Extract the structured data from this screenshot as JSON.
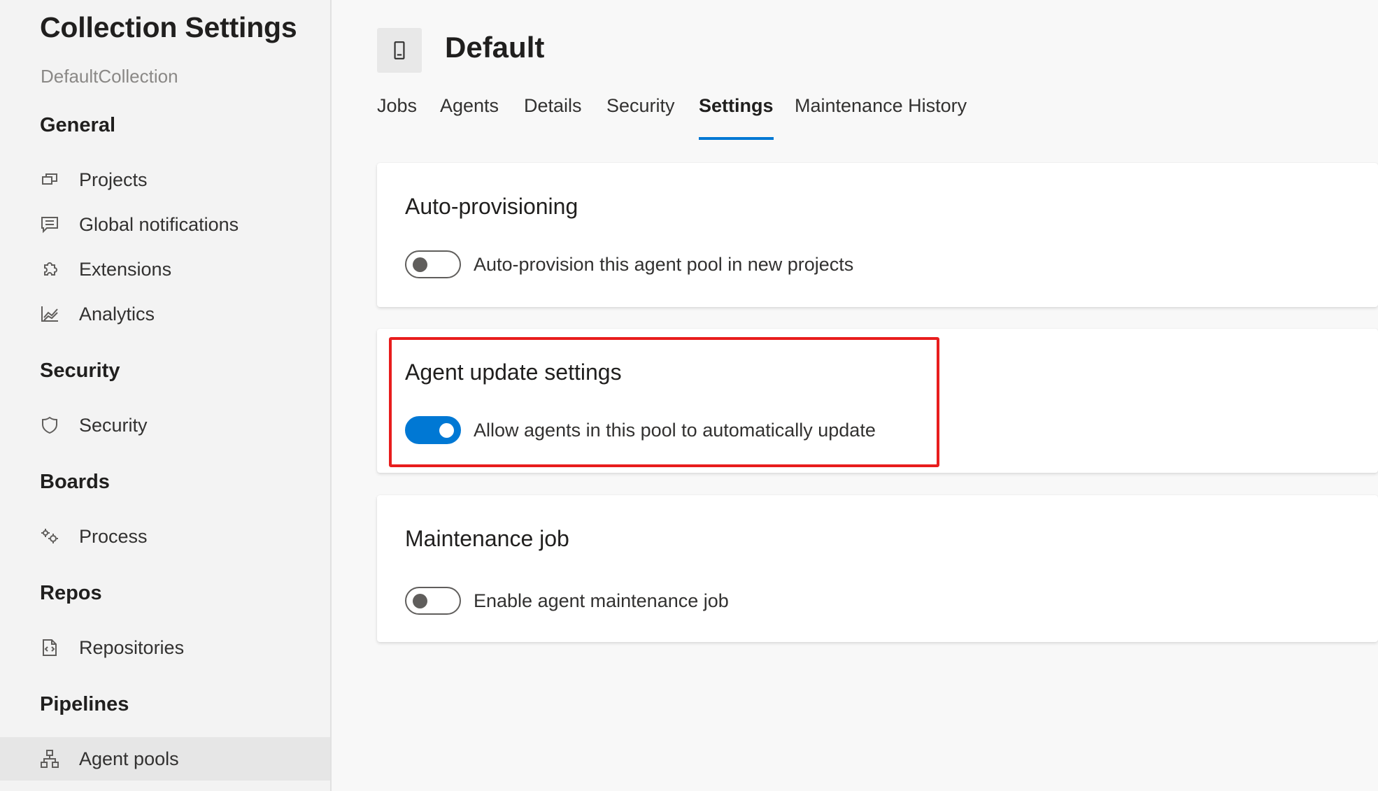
{
  "sidebar": {
    "title": "Collection Settings",
    "subtitle": "DefaultCollection",
    "groups": [
      {
        "header": "General",
        "items": [
          {
            "label": "Projects",
            "icon": "projects-icon"
          },
          {
            "label": "Global notifications",
            "icon": "notifications-icon"
          },
          {
            "label": "Extensions",
            "icon": "extensions-icon"
          },
          {
            "label": "Analytics",
            "icon": "analytics-icon"
          }
        ]
      },
      {
        "header": "Security",
        "items": [
          {
            "label": "Security",
            "icon": "shield-icon"
          }
        ]
      },
      {
        "header": "Boards",
        "items": [
          {
            "label": "Process",
            "icon": "process-icon"
          }
        ]
      },
      {
        "header": "Repos",
        "items": [
          {
            "label": "Repositories",
            "icon": "repositories-icon"
          }
        ]
      },
      {
        "header": "Pipelines",
        "items": [
          {
            "label": "Agent pools",
            "icon": "agent-pools-icon",
            "selected": true
          }
        ]
      }
    ]
  },
  "main": {
    "pool_title": "Default",
    "pool_icon": "device-icon",
    "tabs": [
      {
        "label": "Jobs"
      },
      {
        "label": "Agents"
      },
      {
        "label": "Details"
      },
      {
        "label": "Security"
      },
      {
        "label": "Settings",
        "active": true
      },
      {
        "label": "Maintenance History"
      }
    ],
    "cards": [
      {
        "title": "Auto-provisioning",
        "toggle_label": "Auto-provision this agent pool in new projects",
        "toggle_on": false
      },
      {
        "title": "Agent update settings",
        "toggle_label": "Allow agents in this pool to automatically update",
        "toggle_on": true,
        "highlighted": true
      },
      {
        "title": "Maintenance job",
        "toggle_label": "Enable agent maintenance job",
        "toggle_on": false
      }
    ]
  },
  "colors": {
    "accent": "#0078d4",
    "highlight": "#e81d1d",
    "sidebar_bg": "#f3f3f3",
    "selected_bg": "#e6e6e6"
  }
}
